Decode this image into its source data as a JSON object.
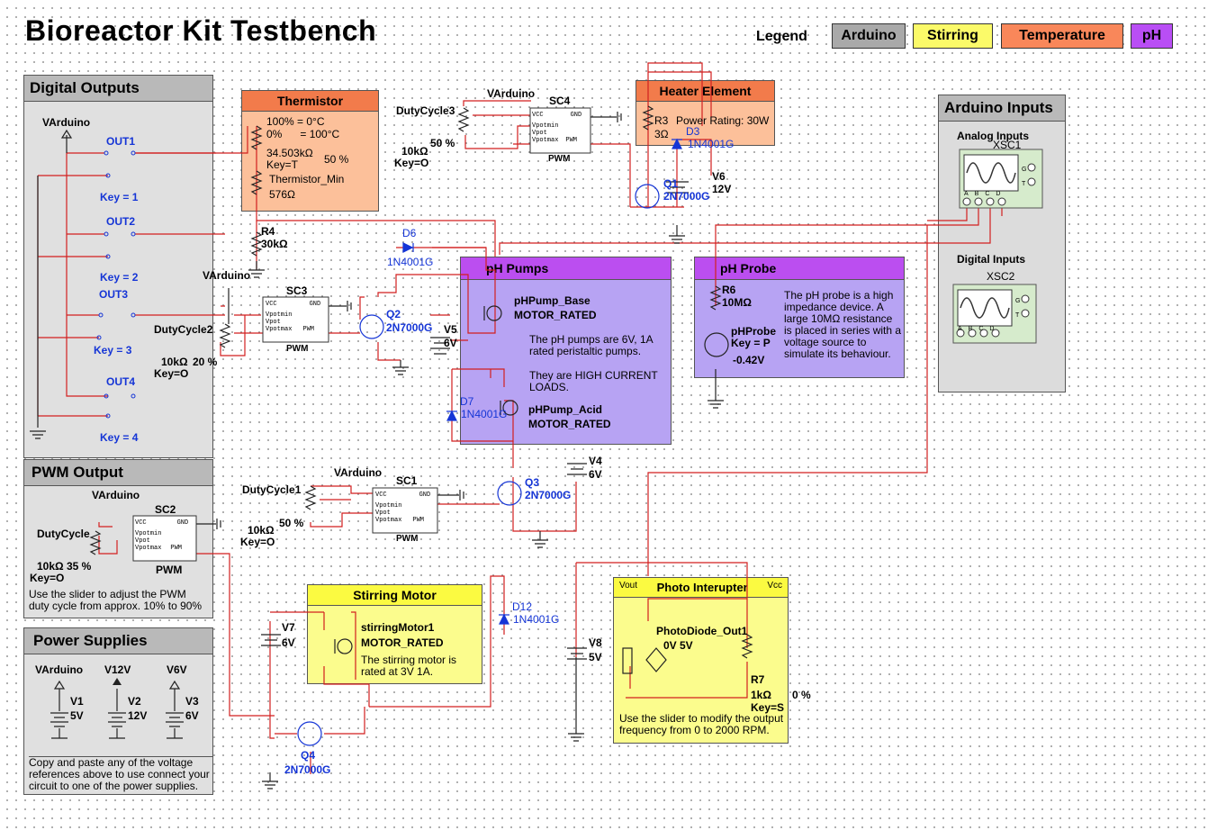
{
  "title": "Bioreactor Kit Testbench",
  "legend": {
    "label": "Legend",
    "items": [
      {
        "label": "Arduino",
        "color": "#a9a9a9"
      },
      {
        "label": "Stirring",
        "color": "#fbfa69"
      },
      {
        "label": "Temperature",
        "color": "#f9875a"
      },
      {
        "label": "pH",
        "color": "#b94ef5"
      }
    ]
  },
  "panels": {
    "digital_outputs": {
      "title": "Digital Outputs",
      "supply": "VArduino",
      "outputs": [
        "OUT1",
        "OUT2",
        "OUT3",
        "OUT4"
      ],
      "keys": [
        "Key = 1",
        "Key = 2",
        "Key = 3",
        "Key = 4"
      ]
    },
    "pwm_output": {
      "title": "PWM Output",
      "supply": "VArduino",
      "ref": "SC2",
      "pot_name": "DutyCycle",
      "pot_value": "10kΩ 35 %",
      "pot_key": "Key=O",
      "pwm_label": "PWM",
      "note": "Use the slider to adjust the PWM duty cycle from approx. 10% to 90%"
    },
    "power_supplies": {
      "title": "Power Supplies",
      "rails": [
        {
          "name": "VArduino",
          "ref": "V1",
          "value": "5V"
        },
        {
          "name": "V12V",
          "ref": "V2",
          "value": "12V"
        },
        {
          "name": "V6V",
          "ref": "V3",
          "value": "6V"
        }
      ],
      "note": "Copy and paste any of the voltage references above to use connect your circuit to one of the power supplies."
    },
    "thermistor": {
      "title": "Thermistor",
      "line1": "100% = 0°C",
      "line2": "0%      = 100°C",
      "value": "34.503kΩ",
      "key": "Key=T",
      "percent": "50 %",
      "name": "Thermistor_Min",
      "resistance": "576Ω"
    },
    "heater": {
      "title": "Heater Element",
      "ref": "R3",
      "value": "3Ω",
      "rating": "Power Rating: 30W"
    },
    "ph_pumps": {
      "title": "pH Pumps",
      "pump1_name": "pHPump_Base",
      "pump1_type": "MOTOR_RATED",
      "pump2_name": "pHPump_Acid",
      "pump2_type": "MOTOR_RATED",
      "note1": "The pH pumps are 6V, 1A rated peristaltic pumps.",
      "note2": "They are HIGH CURRENT LOADS."
    },
    "ph_probe": {
      "title": "pH Probe",
      "ref": "R6",
      "value": "10MΩ",
      "name": "pHProbe",
      "key": "Key = P",
      "voltage": "-0.42V",
      "note": "The pH probe is a high impedance device. A large 10MΩ resistance is placed in series with a voltage source to simulate its behaviour."
    },
    "arduino_inputs": {
      "title": "Arduino Inputs",
      "analog_label": "Analog Inputs",
      "analog_ref": "XSC1",
      "digital_label": "Digital Inputs",
      "digital_ref": "XSC2",
      "pins": [
        "A",
        "B",
        "C",
        "D"
      ],
      "side_pins": [
        "G",
        "T"
      ]
    },
    "stirring_motor": {
      "title": "Stirring Motor",
      "name": "stirringMotor1",
      "type": "MOTOR_RATED",
      "note": "The stirring motor is rated at 3V 1A."
    },
    "photo_interupter": {
      "title": "Photo Interupter",
      "vout": "Vout",
      "vcc": "Vcc",
      "name": "PhotoDiode_Out1",
      "range": "0V 5V",
      "ref": "R7",
      "value": "1kΩ",
      "key": "Key=S",
      "percent": "0 %",
      "note": "Use the slider to modify the output frequency from 0 to 2000 RPM."
    }
  },
  "components": {
    "sc4": {
      "ref": "SC4",
      "supply": "VArduino",
      "pot": "DutyCycle3",
      "pot_pct": "50 %",
      "pot_val": "10kΩ",
      "key": "Key=O",
      "pwm": "PWM"
    },
    "sc3": {
      "ref": "SC3",
      "supply": "VArduino",
      "pot": "DutyCycle2",
      "pot_pct": "20 %",
      "pot_val": "10kΩ",
      "key": "Key=O",
      "pwm": "PWM"
    },
    "sc1": {
      "ref": "SC1",
      "supply": "VArduino",
      "pot": "DutyCycle1",
      "pot_pct": "50 %",
      "pot_val": "10kΩ",
      "key": "Key=O",
      "pwm": "PWM"
    },
    "r4": {
      "ref": "R4",
      "value": "30kΩ"
    },
    "d6": {
      "ref": "D6",
      "part": "1N4001G"
    },
    "d3": {
      "ref": "D3",
      "part": "1N4001G"
    },
    "d7": {
      "ref": "D7",
      "part": "1N4001G"
    },
    "d12": {
      "ref": "D12",
      "part": "1N4001G"
    },
    "q1": {
      "ref": "Q1",
      "part": "2N7000G"
    },
    "q2": {
      "ref": "Q2",
      "part": "2N7000G"
    },
    "q3": {
      "ref": "Q3",
      "part": "2N7000G"
    },
    "q4": {
      "ref": "Q4",
      "part": "2N7000G"
    },
    "v6": {
      "ref": "V6",
      "value": "12V"
    },
    "v5": {
      "ref": "V5",
      "value": "6V"
    },
    "v4": {
      "ref": "V4",
      "value": "6V"
    },
    "v7": {
      "ref": "V7",
      "value": "6V"
    },
    "v8": {
      "ref": "V8",
      "value": "5V"
    },
    "sc_pins": {
      "vcc": "VCC",
      "gnd": "GND",
      "vpotmin": "Vpotmin",
      "vpot": "Vpot",
      "vpotmax": "Vpotmax",
      "pwm": "PWM"
    }
  },
  "colors": {
    "wire_red": "#d21f1f",
    "wire_dark": "#222222",
    "diode_blue": "#1535d6"
  }
}
